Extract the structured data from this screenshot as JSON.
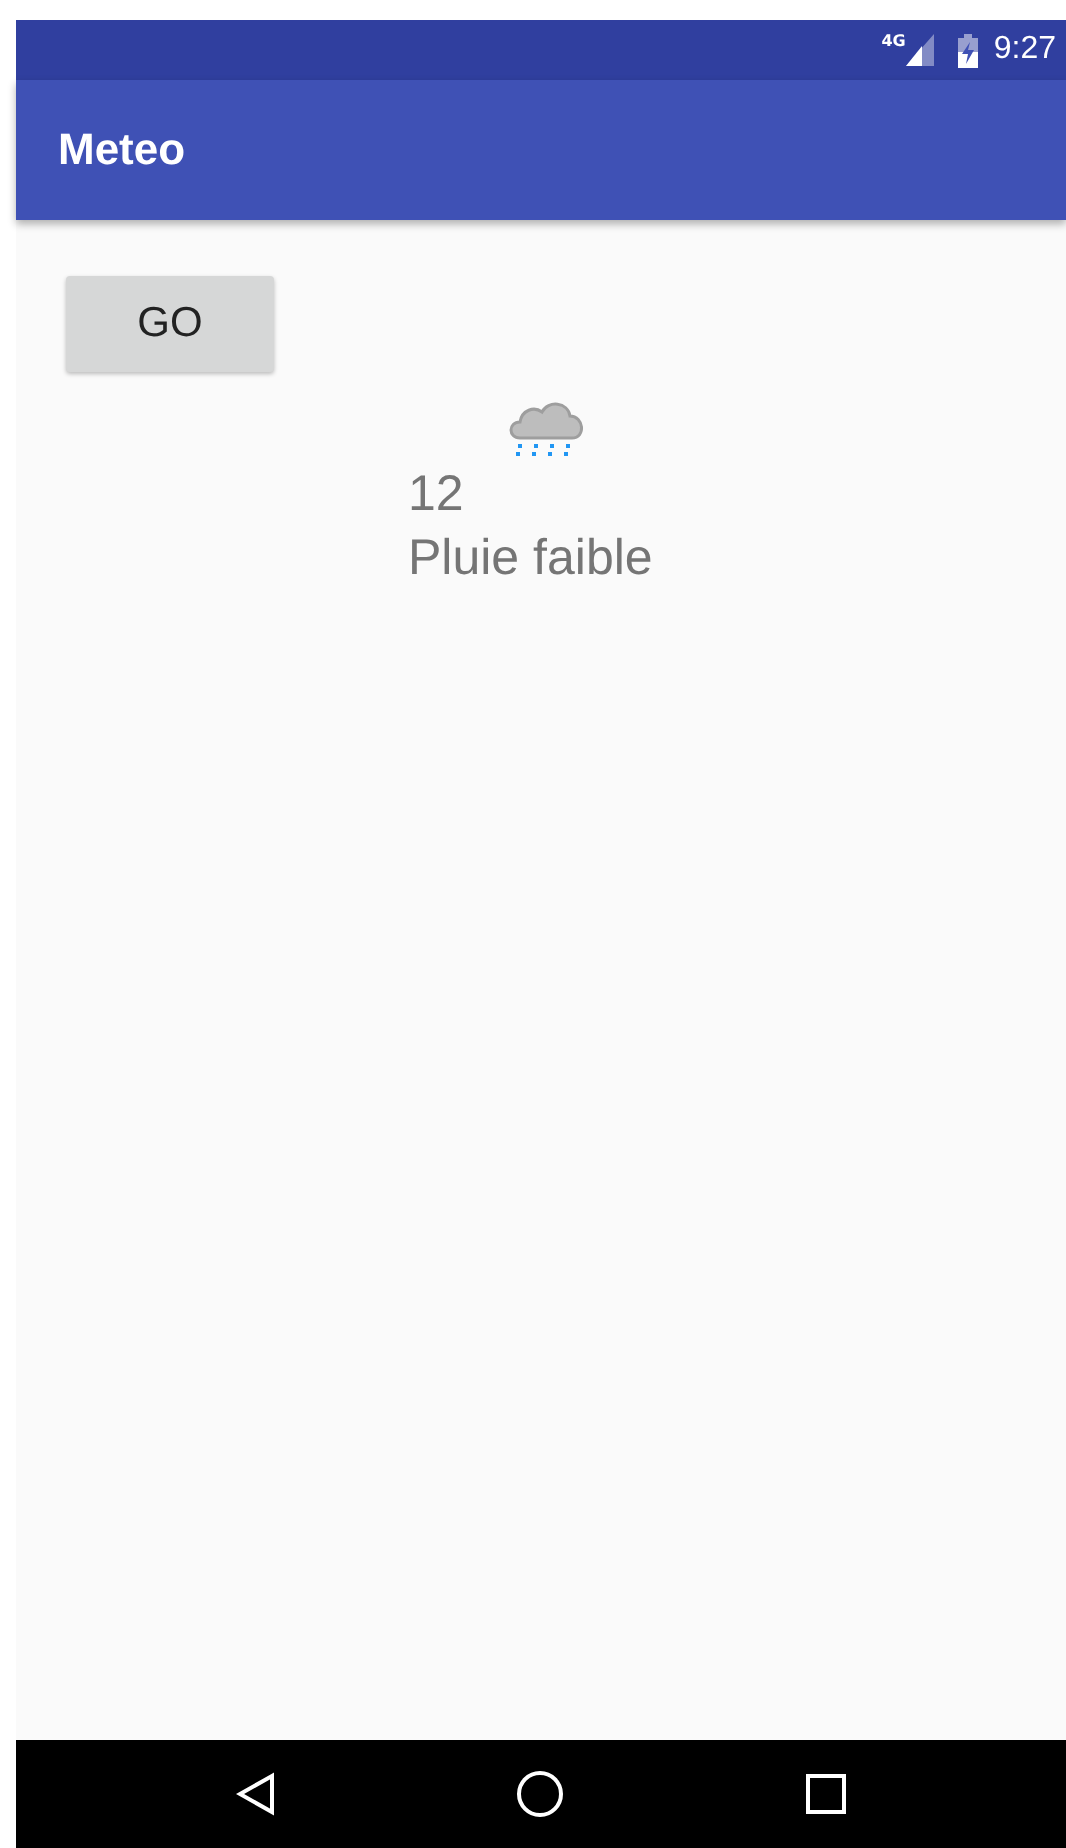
{
  "status_bar": {
    "network": "4G",
    "time": "9:27"
  },
  "app_bar": {
    "title": "Meteo"
  },
  "go_button": {
    "label": "GO"
  },
  "weather": {
    "temperature": "12",
    "description": "Pluie faible"
  }
}
